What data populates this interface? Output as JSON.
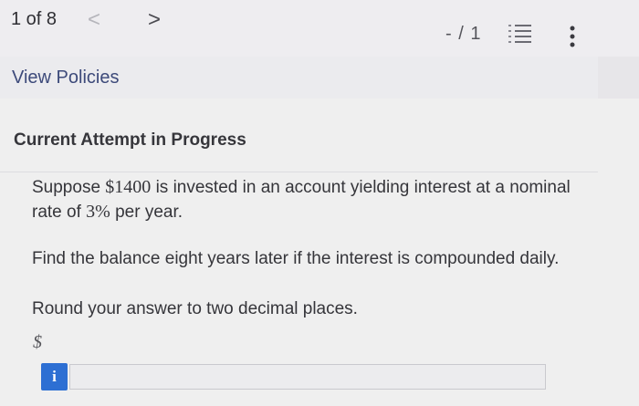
{
  "header": {
    "counter": "1 of 8",
    "prev_glyph": "<",
    "next_glyph": ">",
    "score": "- / 1",
    "list_icon": "numbered-list-icon",
    "more_icon": "vertical-dots-icon"
  },
  "policies": {
    "link": "View Policies"
  },
  "question": {
    "attempt_label": "Current Attempt in Progress",
    "setup_pre": "Suppose ",
    "amount": "$1400",
    "setup_mid": " is invested in an account yielding interest at a nominal rate of ",
    "rate": "3%",
    "setup_post": " per year.",
    "find": "Find the balance eight years later if the interest is compounded daily.",
    "round": "Round your answer to two decimal places.",
    "currency": "$"
  },
  "answer": {
    "info_label": "i",
    "value": ""
  },
  "colors": {
    "link": "#3d4a7a",
    "info_badge": "#2d6fd3"
  }
}
